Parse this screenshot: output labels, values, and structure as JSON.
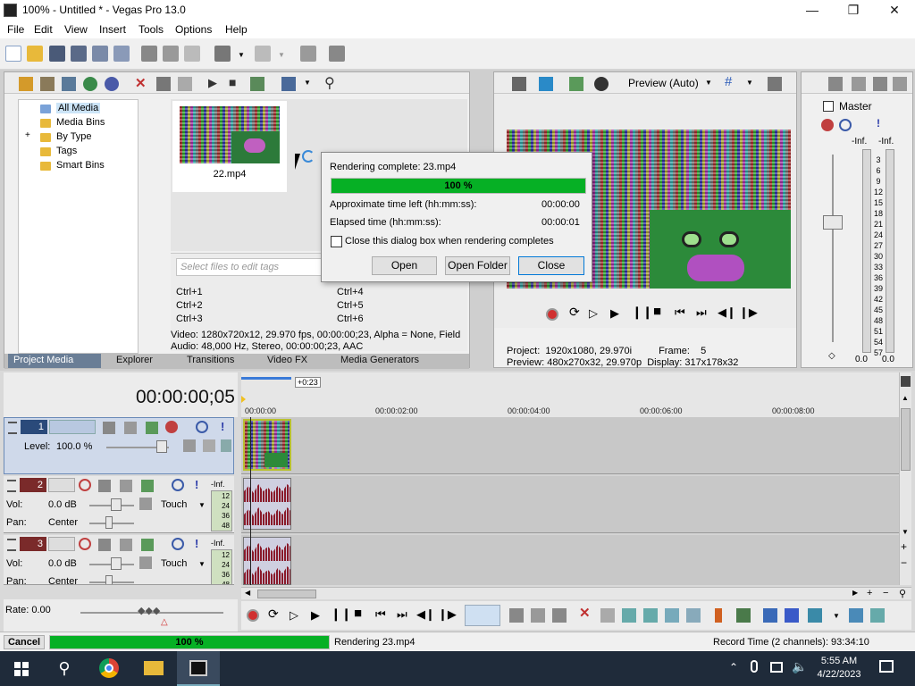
{
  "window": {
    "title": "100% - Untitled * - Vegas Pro 13.0",
    "controls": [
      "minimize-icon",
      "maximize-icon",
      "close-icon"
    ]
  },
  "menu": [
    "File",
    "Edit",
    "View",
    "Insert",
    "Tools",
    "Options",
    "Help"
  ],
  "project_media": {
    "tree": [
      "All Media",
      "Media Bins",
      "By Type",
      "Tags",
      "Smart Bins"
    ],
    "expander": "+",
    "thumb_label": "22.mp4",
    "tags_placeholder": "Select files to edit tags",
    "shortcuts_left": [
      "Ctrl+1",
      "Ctrl+2",
      "Ctrl+3"
    ],
    "shortcuts_right": [
      "Ctrl+4",
      "Ctrl+5",
      "Ctrl+6"
    ],
    "info_video": "Video: 1280x720x12, 29.970 fps, 00:00:00;23, Alpha = None, Field",
    "info_audio": "Audio: 48,000 Hz, Stereo, 00:00:00;23, AAC"
  },
  "tabs": [
    "Project Media",
    "Explorer",
    "Transitions",
    "Video FX",
    "Media Generators"
  ],
  "preview": {
    "mode": "Preview (Auto)",
    "project_label": "Project:",
    "project_value": "1920x1080, 29.970i",
    "frame_label": "Frame:",
    "frame_value": "5",
    "preview_label": "Preview:",
    "preview_value": "480x270x32, 29.970p",
    "display_label": "Display:",
    "display_value": "317x178x32"
  },
  "master": {
    "title": "Master",
    "inf_left": "-Inf.",
    "inf_right": "-Inf.",
    "scale": [
      "3",
      "6",
      "9",
      "12",
      "15",
      "18",
      "21",
      "24",
      "27",
      "30",
      "33",
      "36",
      "39",
      "42",
      "45",
      "48",
      "51",
      "54",
      "57"
    ],
    "value_left": "0.0",
    "value_right": "0.0"
  },
  "dialog": {
    "title": "Rendering complete: 23.mp4",
    "progress_percent": 100,
    "progress_label": "100 %",
    "time_left_label": "Approximate time left (hh:mm:ss):",
    "time_left_value": "00:00:00",
    "elapsed_label": "Elapsed time (hh:mm:ss):",
    "elapsed_value": "00:00:01",
    "checkbox_label": "Close this dialog box when rendering completes",
    "checkbox_checked": false,
    "buttons": [
      "Open",
      "Open Folder",
      "Close"
    ]
  },
  "timeline": {
    "timecode": "00:00:00;05",
    "marker": "+0:23",
    "ruler": [
      "00:00:00",
      "00:00:02:00",
      "00:00:04:00",
      "00:00:06:00",
      "00:00:08:00"
    ],
    "tracks": [
      {
        "num": "1",
        "type": "video",
        "level_label": "Level:",
        "level_value": "100.0 %"
      },
      {
        "num": "2",
        "type": "audio",
        "vol_label": "Vol:",
        "vol_value": "0.0 dB",
        "pan_label": "Pan:",
        "pan_value": "Center",
        "mode": "Touch",
        "inf": "-Inf.",
        "scale": [
          "12",
          "24",
          "36",
          "48"
        ]
      },
      {
        "num": "3",
        "type": "audio",
        "vol_label": "Vol:",
        "vol_value": "0.0 dB",
        "pan_label": "Pan:",
        "pan_value": "Center",
        "mode": "Touch",
        "inf": "-Inf.",
        "scale": [
          "12",
          "24",
          "36",
          "48"
        ]
      }
    ],
    "rate_label": "Rate: 0.00"
  },
  "status": {
    "cancel": "Cancel",
    "progress_percent": 100,
    "progress_label": "100 %",
    "rendering": "Rendering 23.mp4",
    "record_time": "Record Time (2 channels): 93:34:10"
  },
  "taskbar": {
    "time": "5:55 AM",
    "date": "4/22/2023"
  },
  "colors": {
    "progress_green": "#06b025",
    "video_track": "#cfd9ea",
    "active_tab": "#6a7e96",
    "taskbar": "#1f2b3a"
  }
}
